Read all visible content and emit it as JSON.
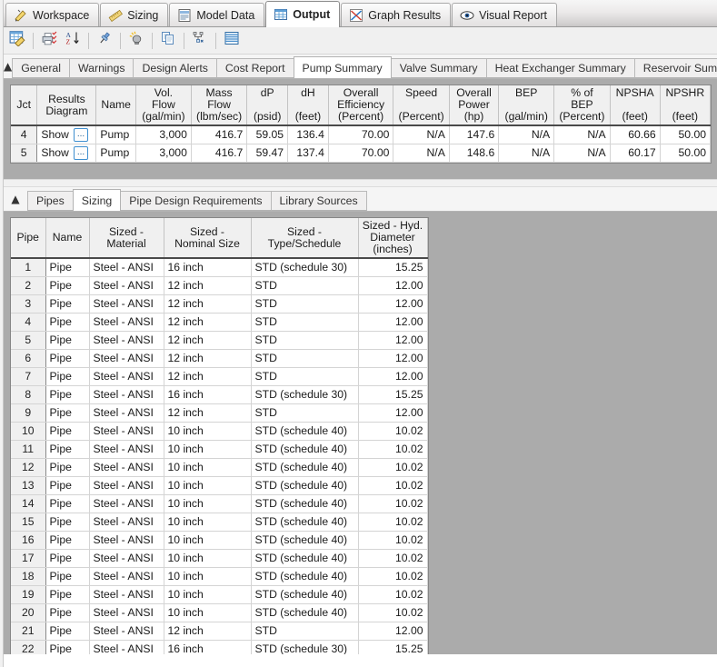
{
  "primary_tabs": [
    {
      "label": "Workspace",
      "icon": "pencil-workspace-icon",
      "active": false
    },
    {
      "label": "Sizing",
      "icon": "ruler-icon",
      "active": false
    },
    {
      "label": "Model Data",
      "icon": "model-data-icon",
      "active": false
    },
    {
      "label": "Output",
      "icon": "output-grid-icon",
      "active": true
    },
    {
      "label": "Graph Results",
      "icon": "graph-results-icon",
      "active": false
    },
    {
      "label": "Visual Report",
      "icon": "eye-icon",
      "active": false
    }
  ],
  "toolbar": {
    "buttons": [
      {
        "name": "edit-grid-icon",
        "title": "Output Control"
      },
      {
        "name": "print-check-icon",
        "title": "Print Content"
      },
      {
        "name": "sort-az-icon",
        "title": "Sort"
      },
      {
        "name": "pin-icon",
        "title": "Pin"
      },
      {
        "name": "bulb-icon",
        "title": "Show Hint"
      },
      {
        "name": "copy-icon",
        "title": "Copy"
      },
      {
        "name": "hierarchy-icon",
        "title": "Arrange"
      },
      {
        "name": "lines-icon",
        "title": "List"
      }
    ]
  },
  "output_panel": {
    "collapse_icon": "chevron-up-icon",
    "tabs": [
      {
        "label": "General",
        "active": false
      },
      {
        "label": "Warnings",
        "active": false
      },
      {
        "label": "Design Alerts",
        "active": false
      },
      {
        "label": "Cost Report",
        "active": false
      },
      {
        "label": "Pump Summary",
        "active": true
      },
      {
        "label": "Valve Summary",
        "active": false
      },
      {
        "label": "Heat Exchanger Summary",
        "active": false
      },
      {
        "label": "Reservoir Summary",
        "active": false
      }
    ],
    "table": {
      "columns": [
        {
          "lines": [
            "Jct"
          ]
        },
        {
          "lines": [
            "Results",
            "Diagram"
          ]
        },
        {
          "lines": [
            "Name"
          ]
        },
        {
          "lines": [
            "Vol.",
            "Flow",
            "(gal/min)"
          ]
        },
        {
          "lines": [
            "Mass",
            "Flow",
            "(lbm/sec)"
          ]
        },
        {
          "lines": [
            "dP",
            "",
            "(psid)"
          ]
        },
        {
          "lines": [
            "dH",
            "",
            "(feet)"
          ]
        },
        {
          "lines": [
            "Overall",
            "Efficiency",
            "(Percent)"
          ]
        },
        {
          "lines": [
            "Speed",
            "",
            "(Percent)"
          ]
        },
        {
          "lines": [
            "Overall",
            "Power",
            "(hp)"
          ]
        },
        {
          "lines": [
            "BEP",
            "",
            "(gal/min)"
          ]
        },
        {
          "lines": [
            "% of",
            "BEP",
            "(Percent)"
          ]
        },
        {
          "lines": [
            "NPSHA",
            "",
            "(feet)"
          ]
        },
        {
          "lines": [
            "NPSHR",
            "",
            "(feet)"
          ]
        }
      ],
      "rows": [
        {
          "jct": "4",
          "results_diagram": "Show",
          "dots_button": "...",
          "name": "Pump",
          "vol_flow": "3,000",
          "mass_flow": "416.7",
          "dP": "59.05",
          "dH": "136.4",
          "overall_efficiency": "70.00",
          "speed": "N/A",
          "overall_power": "147.6",
          "bep": "N/A",
          "pct_bep": "N/A",
          "npsha": "60.66",
          "npshr": "50.00"
        },
        {
          "jct": "5",
          "results_diagram": "Show",
          "dots_button": "...",
          "name": "Pump",
          "vol_flow": "3,000",
          "mass_flow": "416.7",
          "dP": "59.47",
          "dH": "137.4",
          "overall_efficiency": "70.00",
          "speed": "N/A",
          "overall_power": "148.6",
          "bep": "N/A",
          "pct_bep": "N/A",
          "npsha": "60.17",
          "npshr": "50.00"
        }
      ]
    }
  },
  "sizing_panel": {
    "collapse_icon": "chevron-up-icon",
    "tabs": [
      {
        "label": "Pipes",
        "active": false
      },
      {
        "label": "Sizing",
        "active": true
      },
      {
        "label": "Pipe Design Requirements",
        "active": false
      },
      {
        "label": "Library Sources",
        "active": false
      }
    ],
    "table": {
      "columns": [
        {
          "lines": [
            "Pipe"
          ]
        },
        {
          "lines": [
            "Name"
          ]
        },
        {
          "lines": [
            "Sized -",
            "Material"
          ]
        },
        {
          "lines": [
            "Sized -",
            "Nominal Size"
          ]
        },
        {
          "lines": [
            "Sized -",
            "Type/Schedule"
          ]
        },
        {
          "lines": [
            "Sized - Hyd.",
            "Diameter",
            "(inches)"
          ]
        }
      ],
      "rows": [
        {
          "pipe": "1",
          "name": "Pipe",
          "material": "Steel - ANSI",
          "nominal": "16 inch",
          "schedule": "STD (schedule 30)",
          "hyd_dia": "15.25"
        },
        {
          "pipe": "2",
          "name": "Pipe",
          "material": "Steel - ANSI",
          "nominal": "12 inch",
          "schedule": "STD",
          "hyd_dia": "12.00"
        },
        {
          "pipe": "3",
          "name": "Pipe",
          "material": "Steel - ANSI",
          "nominal": "12 inch",
          "schedule": "STD",
          "hyd_dia": "12.00"
        },
        {
          "pipe": "4",
          "name": "Pipe",
          "material": "Steel - ANSI",
          "nominal": "12 inch",
          "schedule": "STD",
          "hyd_dia": "12.00"
        },
        {
          "pipe": "5",
          "name": "Pipe",
          "material": "Steel - ANSI",
          "nominal": "12 inch",
          "schedule": "STD",
          "hyd_dia": "12.00"
        },
        {
          "pipe": "6",
          "name": "Pipe",
          "material": "Steel - ANSI",
          "nominal": "12 inch",
          "schedule": "STD",
          "hyd_dia": "12.00"
        },
        {
          "pipe": "7",
          "name": "Pipe",
          "material": "Steel - ANSI",
          "nominal": "12 inch",
          "schedule": "STD",
          "hyd_dia": "12.00"
        },
        {
          "pipe": "8",
          "name": "Pipe",
          "material": "Steel - ANSI",
          "nominal": "16 inch",
          "schedule": "STD (schedule 30)",
          "hyd_dia": "15.25"
        },
        {
          "pipe": "9",
          "name": "Pipe",
          "material": "Steel - ANSI",
          "nominal": "12 inch",
          "schedule": "STD",
          "hyd_dia": "12.00"
        },
        {
          "pipe": "10",
          "name": "Pipe",
          "material": "Steel - ANSI",
          "nominal": "10 inch",
          "schedule": "STD (schedule 40)",
          "hyd_dia": "10.02"
        },
        {
          "pipe": "11",
          "name": "Pipe",
          "material": "Steel - ANSI",
          "nominal": "10 inch",
          "schedule": "STD (schedule 40)",
          "hyd_dia": "10.02"
        },
        {
          "pipe": "12",
          "name": "Pipe",
          "material": "Steel - ANSI",
          "nominal": "10 inch",
          "schedule": "STD (schedule 40)",
          "hyd_dia": "10.02"
        },
        {
          "pipe": "13",
          "name": "Pipe",
          "material": "Steel - ANSI",
          "nominal": "10 inch",
          "schedule": "STD (schedule 40)",
          "hyd_dia": "10.02"
        },
        {
          "pipe": "14",
          "name": "Pipe",
          "material": "Steel - ANSI",
          "nominal": "10 inch",
          "schedule": "STD (schedule 40)",
          "hyd_dia": "10.02"
        },
        {
          "pipe": "15",
          "name": "Pipe",
          "material": "Steel - ANSI",
          "nominal": "10 inch",
          "schedule": "STD (schedule 40)",
          "hyd_dia": "10.02"
        },
        {
          "pipe": "16",
          "name": "Pipe",
          "material": "Steel - ANSI",
          "nominal": "10 inch",
          "schedule": "STD (schedule 40)",
          "hyd_dia": "10.02"
        },
        {
          "pipe": "17",
          "name": "Pipe",
          "material": "Steel - ANSI",
          "nominal": "10 inch",
          "schedule": "STD (schedule 40)",
          "hyd_dia": "10.02"
        },
        {
          "pipe": "18",
          "name": "Pipe",
          "material": "Steel - ANSI",
          "nominal": "10 inch",
          "schedule": "STD (schedule 40)",
          "hyd_dia": "10.02"
        },
        {
          "pipe": "19",
          "name": "Pipe",
          "material": "Steel - ANSI",
          "nominal": "10 inch",
          "schedule": "STD (schedule 40)",
          "hyd_dia": "10.02"
        },
        {
          "pipe": "20",
          "name": "Pipe",
          "material": "Steel - ANSI",
          "nominal": "10 inch",
          "schedule": "STD (schedule 40)",
          "hyd_dia": "10.02"
        },
        {
          "pipe": "21",
          "name": "Pipe",
          "material": "Steel - ANSI",
          "nominal": "12 inch",
          "schedule": "STD",
          "hyd_dia": "12.00"
        },
        {
          "pipe": "22",
          "name": "Pipe",
          "material": "Steel - ANSI",
          "nominal": "16 inch",
          "schedule": "STD (schedule 30)",
          "hyd_dia": "15.25"
        }
      ]
    }
  },
  "colors": {
    "accent_blue": "#3f8fd0",
    "grid_header_bg": "#f0f0f0",
    "panel_gray": "#ababab"
  }
}
